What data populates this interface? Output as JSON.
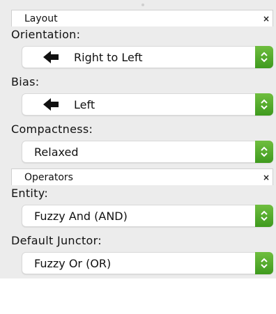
{
  "layout_panel": {
    "title": "Layout",
    "close_label": "×",
    "orientation": {
      "label": "Orientation:",
      "value": "Right to Left",
      "icon": "left-arrow-icon"
    },
    "bias": {
      "label": "Bias:",
      "value": "Left",
      "icon": "left-arrow-icon"
    },
    "compactness": {
      "label": "Compactness:",
      "value": "Relaxed"
    }
  },
  "operators_panel": {
    "title": "Operators",
    "close_label": "×",
    "entity": {
      "label": "Entity:",
      "value": "Fuzzy And (AND)"
    },
    "default_junctor": {
      "label": "Default Junctor:",
      "value": "Fuzzy Or (OR)"
    }
  },
  "colors": {
    "stepper_green": "#4caf28",
    "panel_bg": "#ececec"
  }
}
